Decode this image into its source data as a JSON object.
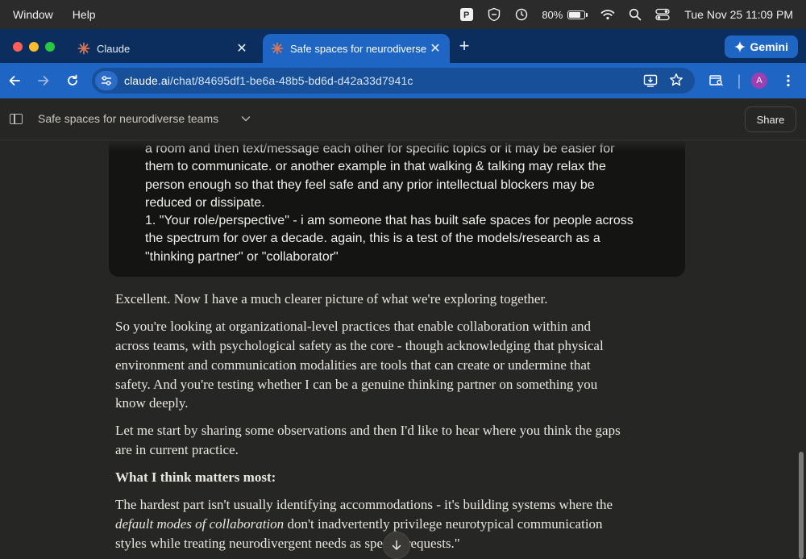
{
  "menubar": {
    "items": [
      "Window",
      "Help"
    ],
    "battery_percent": "80%",
    "battery_level": 0.8,
    "datetime": "Tue Nov 25  11:09 PM"
  },
  "tabs": [
    {
      "title": "Claude",
      "active": false
    },
    {
      "title": "Safe spaces for neurodiverse",
      "active": true
    }
  ],
  "gemini_label": "Gemini",
  "toolbar": {
    "url_host": "claude.ai",
    "url_path": "/chat/84695df1-be6a-48b5-bd6d-d42a33d7941c"
  },
  "profile": {
    "initial": "A"
  },
  "header": {
    "chat_title": "Safe spaces for neurodiverse teams",
    "share_label": "Share"
  },
  "user_message": {
    "lines": [
      "a room and then text/message each other for specific topics or it may be easier for",
      "them to communicate. or another example in that walking & talking may relax the",
      "person enough so that they feel safe and any prior intellectual blockers may be",
      "reduced or dissipate.",
      "1. \"Your role/perspective\" - i am someone that has built safe spaces for people across",
      "the spectrum for over a decade. again, this is a test of the models/research as a",
      "\"thinking partner\" or \"collaborator\""
    ]
  },
  "assistant": {
    "p1": "Excellent. Now I have a much clearer picture of what we're exploring together.",
    "p2_lines": [
      "So you're looking at organizational-level practices that enable collaboration within and",
      "across teams, with psychological safety as the core - though acknowledging that physical",
      "environment and communication modalities are tools that can create or undermine that",
      "safety. And you're testing whether I can be a genuine thinking partner on something you",
      "know deeply."
    ],
    "p3_lines": [
      "Let me start by sharing some observations and then I'd like to hear where you think the gaps",
      "are in current practice."
    ],
    "heading": "What I think matters most:",
    "p4_line1": "The hardest part isn't usually identifying accommodations - it's building systems where the",
    "p4_line2_italic": "default modes of collaboration",
    "p4_line2_rest": " don't inadvertently privilege neurotypical communication",
    "p4_line3": "styles while treating neurodivergent needs as special requests.\""
  },
  "colors": {
    "menubar_bg": "#2b2b2b",
    "tabstrip_bg": "#0b2e5e",
    "toolbar_bg": "#1f66c4",
    "page_bg": "#262624",
    "user_bubble_bg": "#141413",
    "claude_spark": "#d97757"
  }
}
